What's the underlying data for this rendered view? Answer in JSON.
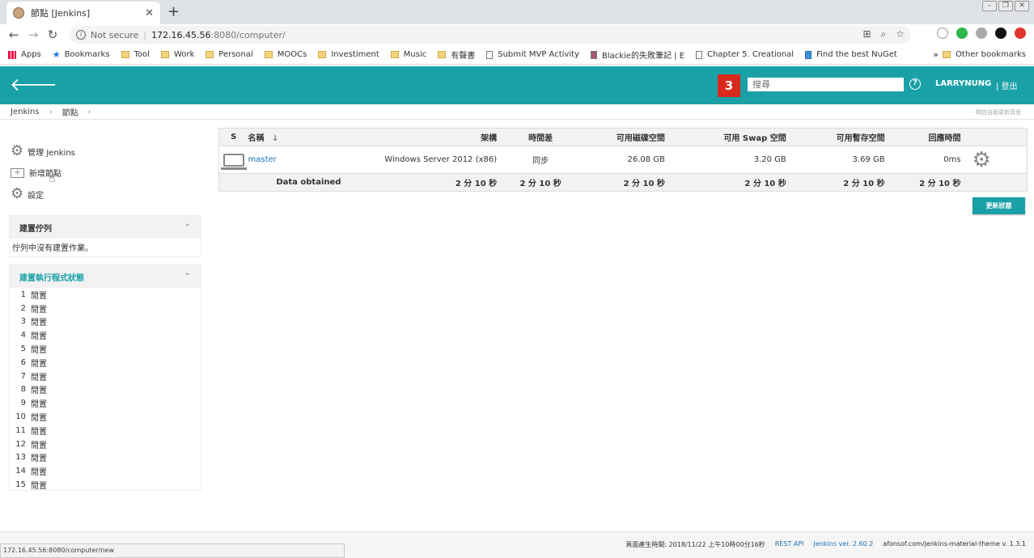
{
  "browser": {
    "tab_title": "節點 [Jenkins]",
    "tab_close": "✕",
    "new_tab": "+",
    "not_secure": "Not secure",
    "url_host": "172.16.45.56",
    "url_path": ":8080/computer/",
    "bookmarks": [
      {
        "label": "Apps",
        "icon": "apps-icon"
      },
      {
        "label": "Bookmarks",
        "icon": "star-icon"
      },
      {
        "label": "Tool",
        "icon": "folder-icon"
      },
      {
        "label": "Work",
        "icon": "folder-icon"
      },
      {
        "label": "Personal",
        "icon": "folder-icon"
      },
      {
        "label": "MOOCs",
        "icon": "folder-icon"
      },
      {
        "label": "Investiment",
        "icon": "folder-icon"
      },
      {
        "label": "Music",
        "icon": "folder-icon"
      },
      {
        "label": "有聲書",
        "icon": "folder-icon"
      },
      {
        "label": "Submit MVP Activity",
        "icon": "page-icon"
      },
      {
        "label": "Blackie的失敗筆記 | E",
        "icon": "avatar-icon"
      },
      {
        "label": "Chapter 5. Creational",
        "icon": "page-icon"
      },
      {
        "label": "Find the best NuGet",
        "icon": "nuget-icon"
      }
    ],
    "bookmarks_more": "»",
    "other_bookmarks": "Other bookmarks"
  },
  "header": {
    "notification_count": "3",
    "search_placeholder": "搜尋",
    "help": "?",
    "user": "LARRYNUNG",
    "logout": "| 登出"
  },
  "breadcrumbs": {
    "items": [
      "Jenkins",
      "節點"
    ],
    "separator": "›",
    "auto_refresh": "開啟自動更新頁面"
  },
  "side_tasks": [
    {
      "label": "管理 Jenkins",
      "icon": "gear-icon"
    },
    {
      "label": "新增節點",
      "icon": "add-node-icon"
    },
    {
      "label": "設定",
      "icon": "gear-icon"
    }
  ],
  "build_queue": {
    "title": "建置佇列",
    "empty": "佇列中沒有建置作業。"
  },
  "executors": {
    "title": "建置執行程式狀態",
    "idle_label": "閒置",
    "numbers": [
      "1",
      "2",
      "3",
      "4",
      "5",
      "6",
      "7",
      "8",
      "9",
      "10",
      "11",
      "12",
      "13",
      "14",
      "15"
    ]
  },
  "nodes_table": {
    "headers": {
      "s": "S",
      "name": "名稱",
      "sort": "↓",
      "arch": "架構",
      "clock": "時間差",
      "disk": "可用磁碟空間",
      "swap": "可用 Swap 空間",
      "temp": "可用暫存空間",
      "response": "回應時間"
    },
    "row": {
      "name": "master",
      "arch": "Windows Server 2012 (x86)",
      "clock": "同步",
      "disk": "26.08 GB",
      "swap": "3.20 GB",
      "temp": "3.69 GB",
      "response": "0ms"
    },
    "footer": {
      "label": "Data obtained",
      "arch": "2 分 10 秒",
      "clock": "2 分 10 秒",
      "disk": "2 分 10 秒",
      "swap": "2 分 10 秒",
      "temp": "2 分 10 秒",
      "response": "2 分 10 秒"
    }
  },
  "refresh_button": "更新狀態",
  "footer": {
    "generated": "頁面產生時間: 2018/11/22 上午10時00分16秒",
    "rest_api": "REST API",
    "version": "Jenkins ver. 2.60.2",
    "theme": "afonsof.com/jenkins-material-theme v. 1.3.1"
  },
  "status_bar_url": "172.16.45.56:8080/computer/new"
}
